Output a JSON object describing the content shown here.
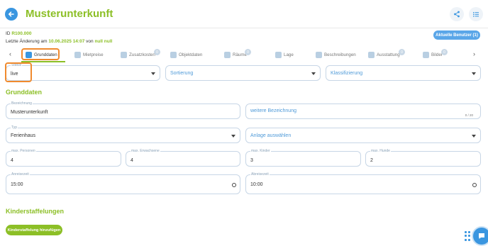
{
  "header": {
    "title": "Musterunterkunft"
  },
  "meta": {
    "id_label": "ID",
    "id_value": "R100.000",
    "changed_prefix": "Letzte Änderung am",
    "changed_date": "10.06.2025 14:07",
    "changed_by_prefix": "von",
    "changed_by": "null null"
  },
  "users_button": "Aktuelle Benutzer (1)",
  "tabs": [
    {
      "label": "Grunddaten",
      "icon": "house-icon",
      "active": true
    },
    {
      "label": "Mietpreise",
      "icon": "chart-icon"
    },
    {
      "label": "Zusatzkosten",
      "icon": "coins-icon",
      "badge": "0"
    },
    {
      "label": "Objektdaten",
      "icon": "home-icon"
    },
    {
      "label": "Räume",
      "icon": "bed-icon",
      "badge": "0"
    },
    {
      "label": "Lage",
      "icon": "location-pin-icon"
    },
    {
      "label": "Beschreibungen",
      "icon": "text-icon"
    },
    {
      "label": "Ausstattung",
      "icon": "amenities-icon",
      "badge": "0"
    },
    {
      "label": "Bilder",
      "icon": "image-icon",
      "badge": "0"
    }
  ],
  "filters": {
    "status_label": "Status",
    "status_value": "live",
    "sortierung_placeholder": "Sortierung",
    "klassifizierung_placeholder": "Klassifizierung"
  },
  "grunddaten": {
    "section_title": "Grunddaten",
    "bezeichnung_label": "Bezeichnung",
    "bezeichnung_value": "Musterunterkunft",
    "weitere_placeholder": "weitere Bezeichnung",
    "weitere_counter": "0 / 20",
    "typ_label": "Typ",
    "typ_value": "Ferienhaus",
    "anlage_placeholder": "Anlage auswählen",
    "max_personen_label": "max. Personen",
    "max_personen_value": "4",
    "max_erwachsene_label": "max. Erwachsene",
    "max_erwachsene_value": "4",
    "max_kinder_label": "max. Kinder",
    "max_kinder_value": "3",
    "max_hunde_label": "max. Hunde",
    "max_hunde_value": "2",
    "anreise_label": "Anreisezeit",
    "anreise_value": "15:00",
    "abreise_label": "Abreisezeit",
    "abreise_value": "10:00"
  },
  "kinder": {
    "section_title": "Kinderstaffelungen",
    "add_button": "Kinderstaffelung hinzufügen"
  },
  "colors": {
    "accent_green": "#8cbf26",
    "primary_blue": "#3a96e0",
    "highlight_orange": "#f08a2e"
  }
}
